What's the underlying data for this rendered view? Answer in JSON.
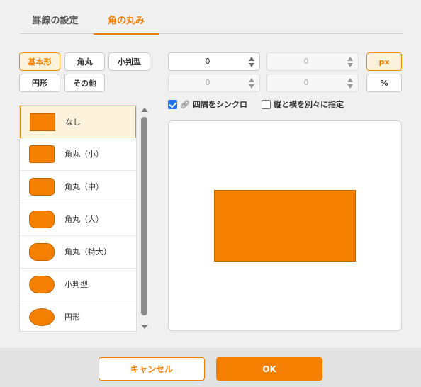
{
  "tabs": [
    {
      "label": "罫線の設定",
      "active": false
    },
    {
      "label": "角の丸み",
      "active": true
    }
  ],
  "presets": [
    {
      "label": "基本形",
      "active": true
    },
    {
      "label": "角丸",
      "active": false
    },
    {
      "label": "小判型",
      "active": false
    },
    {
      "label": "円形",
      "active": false
    },
    {
      "label": "その他",
      "active": false
    }
  ],
  "shape_list": [
    {
      "label": "なし",
      "selected": true
    },
    {
      "label": "角丸（小）",
      "selected": false
    },
    {
      "label": "角丸（中）",
      "selected": false
    },
    {
      "label": "角丸（大）",
      "selected": false
    },
    {
      "label": "角丸（特大）",
      "selected": false
    },
    {
      "label": "小判型",
      "selected": false
    },
    {
      "label": "円形",
      "selected": false
    }
  ],
  "corners": {
    "top_left": "0",
    "top_right": "0",
    "bottom_left": "0",
    "bottom_right": "0"
  },
  "units": {
    "px": "px",
    "percent": "%",
    "active": "px"
  },
  "options": {
    "sync_all": {
      "label": "四隅をシンクロ",
      "checked": true
    },
    "separate_xy": {
      "label": "縦と横を別々に指定",
      "checked": false
    }
  },
  "footer": {
    "cancel": "キャンセル",
    "ok": "OK"
  },
  "colors": {
    "accent": "#f07d00",
    "shape_fill": "#f57f00"
  }
}
